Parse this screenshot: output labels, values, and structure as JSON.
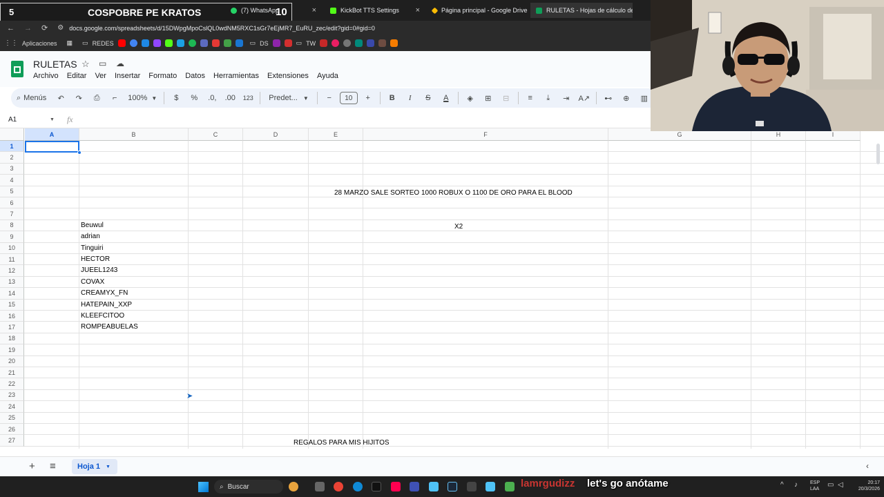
{
  "browser": {
    "overlay_left": "5",
    "overlay_title": "COSPOBRE PE KRATOS",
    "overlay_count": "10",
    "tabs": [
      {
        "label": "(7) WhatsApp",
        "color": "#25d366"
      },
      {
        "label": "KickBot TTS Settings",
        "color": "#53fc18"
      },
      {
        "label": "Página principal - Google Drive",
        "color": "#fbbc04"
      },
      {
        "label": "RULETAS - Hojas de cálculo de",
        "color": "#0f9d58"
      }
    ],
    "url": "docs.google.com/spreadsheets/d/15DWpgMpoCslQL0wdNM5RXC1sGr7eEjMR7_EuRU_zec/edit?gid=0#gid=0",
    "bookmarks": [
      "Aplicaciones",
      "REDES",
      "DS",
      "TW"
    ]
  },
  "docs": {
    "title": "RULETAS",
    "menu": [
      "Archivo",
      "Editar",
      "Ver",
      "Insertar",
      "Formato",
      "Datos",
      "Herramientas",
      "Extensiones",
      "Ayuda"
    ],
    "toolbar": {
      "search_label": "Menús",
      "zoom": "100%",
      "currency": "$",
      "percent": "%",
      "dec_less": ".0,",
      "dec_more": ".00",
      "number_format": "123",
      "font": "Predet...",
      "font_size": "10",
      "minus": "−",
      "plus": "+",
      "bold": "B",
      "italic": "I",
      "strike": "S",
      "textcolor": "A"
    },
    "name_box": "A1",
    "fx": "fx"
  },
  "grid": {
    "columns": [
      "A",
      "B",
      "C",
      "D",
      "E",
      "F",
      "G",
      "H",
      "I"
    ],
    "rows": [
      "1",
      "2",
      "3",
      "4",
      "5",
      "6",
      "7",
      "8",
      "9",
      "10",
      "11",
      "12",
      "13",
      "14",
      "15",
      "16",
      "17",
      "18",
      "19",
      "20",
      "21",
      "22",
      "23",
      "24",
      "25",
      "26",
      "27"
    ],
    "cells": {
      "f5": "28 MARZO SALE SORTEO 1000 ROBUX O 1100 DE ORO PARA EL BLOOD",
      "f8": "X2",
      "b_list": [
        "Beuwul",
        "adrian",
        "Tinguiri",
        "HECTOR",
        "JUEEL1243",
        "COVAX",
        "CREAMYX_FN",
        "HATEPAIN_XXP",
        "KLEEFCITOO",
        "ROMPEABUELAS"
      ],
      "d27": "REGALOS PARA MIS HIJITOS"
    }
  },
  "sheets": {
    "add": "+",
    "list": "≡",
    "active_sheet": "Hoja 1"
  },
  "taskbar": {
    "search": "Buscar",
    "subtitle_left": "lamrgudizz",
    "subtitle": "let's go anótame",
    "lang": "ESP",
    "lang2": "LAA",
    "time": "20:17",
    "date": "20/3/2026"
  },
  "colors": {
    "sheets_green": "#0f9d58",
    "selection_blue": "#1a73e8",
    "toolbar_bg": "#edf2fa",
    "chrome_dark": "#2b2b2b"
  }
}
